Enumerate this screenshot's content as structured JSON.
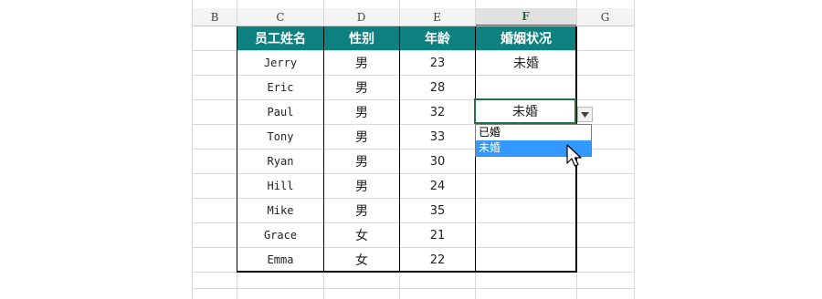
{
  "column_headers": [
    "B",
    "C",
    "D",
    "E",
    "F",
    "G"
  ],
  "active_column": "F",
  "table": {
    "headers": [
      "员工姓名",
      "性别",
      "年龄",
      "婚姻状况"
    ],
    "rows": [
      {
        "name": "Jerry",
        "gender": "男",
        "age": "23",
        "status": "未婚"
      },
      {
        "name": "Eric",
        "gender": "男",
        "age": "28",
        "status": ""
      },
      {
        "name": "Paul",
        "gender": "男",
        "age": "32",
        "status": "未婚"
      },
      {
        "name": "Tony",
        "gender": "男",
        "age": "33",
        "status": ""
      },
      {
        "name": "Ryan",
        "gender": "男",
        "age": "30",
        "status": ""
      },
      {
        "name": "Hill",
        "gender": "男",
        "age": "24",
        "status": ""
      },
      {
        "name": "Mike",
        "gender": "男",
        "age": "35",
        "status": ""
      },
      {
        "name": "Grace",
        "gender": "女",
        "age": "21",
        "status": ""
      },
      {
        "name": "Emma",
        "gender": "女",
        "age": "22",
        "status": ""
      }
    ]
  },
  "dropdown": {
    "options": [
      "已婚",
      "未婚"
    ],
    "selected_index": 1
  },
  "colors": {
    "header_fill": "#0e8080",
    "active_border": "#217346",
    "dropdown_highlight": "#3399ff"
  },
  "icons": [
    "dropdown-arrow-icon",
    "mouse-pointer-icon"
  ]
}
